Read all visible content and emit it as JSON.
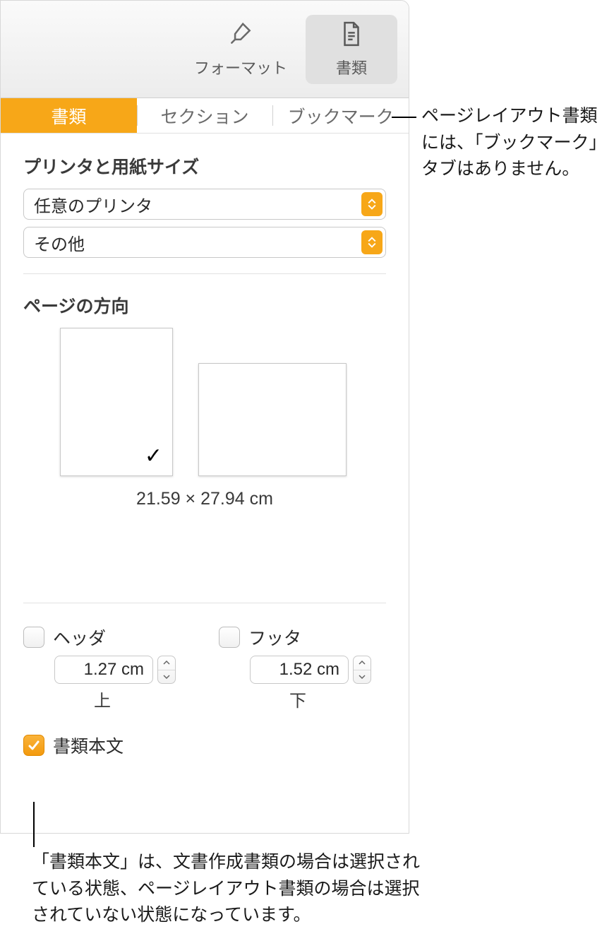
{
  "toolbar": {
    "format_label": "フォーマット",
    "document_label": "書類"
  },
  "tabs": {
    "document": "書類",
    "section": "セクション",
    "bookmark": "ブックマーク"
  },
  "printer_section": {
    "title": "プリンタと用紙サイズ",
    "printer_value": "任意のプリンタ",
    "paper_value": "その他"
  },
  "orientation": {
    "title": "ページの方向",
    "size_text": "21.59 × 27.94 cm"
  },
  "header_footer": {
    "header_label": "ヘッダ",
    "footer_label": "フッタ",
    "header_value": "1.27 cm",
    "footer_value": "1.52 cm",
    "top_label": "上",
    "bottom_label": "下"
  },
  "body_text": {
    "label": "書類本文"
  },
  "callouts": {
    "bookmark_note": "ページレイアウト書類には、「ブックマーク」タブはありません。",
    "body_note": "「書類本文」は、文書作成書類の場合は選択されている状態、ページレイアウト書類の場合は選択されていない状態になっています。"
  }
}
